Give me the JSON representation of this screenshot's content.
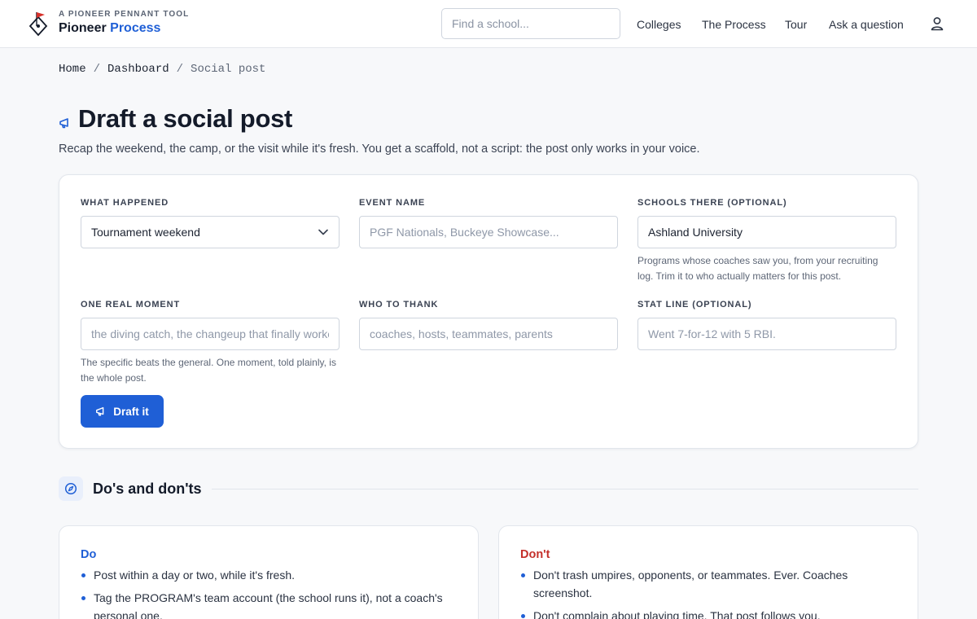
{
  "header": {
    "kicker": "A PIONEER PENNANT TOOL",
    "brand_primary": "Pioneer",
    "brand_accent": "Process",
    "search_placeholder": "Find a school...",
    "nav": [
      "Colleges",
      "The Process",
      "Tour",
      "Ask a question"
    ],
    "icons": {
      "logo": "pennant-logo-icon",
      "user": "user-icon"
    }
  },
  "breadcrumb": {
    "items": [
      "Home",
      "Dashboard",
      "Social post"
    ],
    "separator": "/"
  },
  "page": {
    "title": "Draft a social post",
    "title_icon": "megaphone-icon",
    "subtitle": "Recap the weekend, the camp, or the visit while it's fresh. You get a scaffold, not a script: the post only works in your voice."
  },
  "form": {
    "what_happened": {
      "label": "WHAT HAPPENED",
      "value": "Tournament weekend"
    },
    "event_name": {
      "label": "EVENT NAME",
      "placeholder": "PGF Nationals, Buckeye Showcase..."
    },
    "schools_there": {
      "label": "SCHOOLS THERE (OPTIONAL)",
      "value": "Ashland University",
      "hint": "Programs whose coaches saw you, from your recruiting log. Trim it to who actually matters for this post."
    },
    "one_real_moment": {
      "label": "ONE REAL MOMENT",
      "placeholder": "the diving catch, the changeup that finally worked",
      "hint": "The specific beats the general. One moment, told plainly, is the whole post."
    },
    "who_to_thank": {
      "label": "WHO TO THANK",
      "placeholder": "coaches, hosts, teammates, parents"
    },
    "stat_line": {
      "label": "STAT LINE (OPTIONAL)",
      "placeholder": "Went 7-for-12 with 5 RBI."
    },
    "submit_label": "Draft it"
  },
  "guidelines": {
    "title": "Do's and don'ts",
    "icon": "compass-icon",
    "do": {
      "title": "Do",
      "items": [
        "Post within a day or two, while it's fresh.",
        "Tag the PROGRAM's team account (the school runs it), not a coach's personal one."
      ]
    },
    "dont": {
      "title": "Don't",
      "items": [
        "Don't trash umpires, opponents, or teammates. Ever. Coaches screenshot.",
        "Don't complain about playing time. That post follows you."
      ]
    }
  },
  "colors": {
    "accent": "#1f5fd6",
    "danger": "#c4302b",
    "logo_red": "#d6312b",
    "ink": "#141b2a"
  }
}
